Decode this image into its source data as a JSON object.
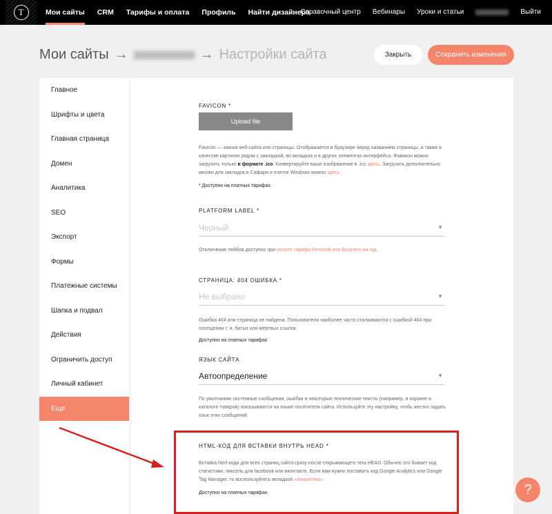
{
  "topnav": {
    "left": [
      {
        "label": "Мои сайты",
        "active": true
      },
      {
        "label": "CRM"
      },
      {
        "label": "Тарифы и оплата"
      },
      {
        "label": "Профиль"
      },
      {
        "label": "Найти дизайнера"
      }
    ],
    "right": [
      "Справочный центр",
      "Вебинары",
      "Уроки и статьи"
    ],
    "logout": "Выйти"
  },
  "breadcrumb": {
    "root": "Мои сайты",
    "arrow": "→",
    "current": "Настройки сайта"
  },
  "buttons": {
    "close": "Закрыть",
    "save": "Сохранить изменения"
  },
  "sidebar": {
    "items": [
      {
        "label": "Главное"
      },
      {
        "label": "Шрифты и цвета"
      },
      {
        "label": "Главная страница"
      },
      {
        "label": "Домен"
      },
      {
        "label": "Аналитика"
      },
      {
        "label": "SEO"
      },
      {
        "label": "Экспорт"
      },
      {
        "label": "Формы"
      },
      {
        "label": "Платежные системы"
      },
      {
        "label": "Шапка и подвал"
      },
      {
        "label": "Действия"
      },
      {
        "label": "Ограничить доступ"
      },
      {
        "label": "Личный кабинет"
      },
      {
        "label": "Еще",
        "active": true
      }
    ]
  },
  "favicon": {
    "label": "FAVICON *",
    "upload": "Upload file",
    "desc_1": "Favicon — значок веб-сайта или страницы. Отображается в браузере перед названием страницы, а также в качестве картинки рядом с закладкой, во вкладках и в других элементах интерфейса. Фавикон можно загрузить только ",
    "desc_bold": "в формате .ico",
    "desc_2": ". Конвертируйте ваше изображение в .ico ",
    "desc_link1": "здесь",
    "desc_3": ". Загрузить дополнительно иконки для закладок в Сафари и плиток Windows можно ",
    "desc_link2": "здесь",
    "note": "* Доступно на платных тарифах."
  },
  "platform_label": {
    "label": "PLATFORM LABEL *",
    "value": "Черный",
    "desc_1": "Отключение лейбла доступно при ",
    "desc_link": "оплате тарифа Personal или Business на год."
  },
  "page404": {
    "label": "СТРАНИЦА: 404 ОШИБКА *",
    "value": "Не выбрано",
    "desc": "Ошибка 404 или страница не найдена. Пользователи наиболее часто сталкиваются с ошибкой 404 при посещении т. н. битых или мёртвых ссылок",
    "note": "Доступно на платных тарифах"
  },
  "language": {
    "label": "ЯЗЫК САЙТА",
    "value": "Автоопределение",
    "desc": "По умолчанию системные сообщения, ошибки и некоторые технические тексты (например, в корзине и каталоге товаров) показываются на языке посетителя сайта. Используйте эту настройку, чтобь жестко задать язык этих сообщений."
  },
  "html_head": {
    "label": "HTML-КОД ДЛЯ ВСТАВКИ ВНУТРЬ HEAD *",
    "desc_1": "Вставка html-кода для всех страниц сайта сразу после открывающего тега HEAD. Обычно это бывает код статистики, пиксель для facebook или вконтакте. Если вам нужно поставить код Google Analytics или Google Tag Manager, то воспользуйтесь вкладкой ",
    "desc_link": "«Аналитика»",
    "note": "Доступно на платных тарифах"
  },
  "help": "?",
  "colors": {
    "accent": "#f4846a",
    "annotation": "#d81f1f"
  }
}
